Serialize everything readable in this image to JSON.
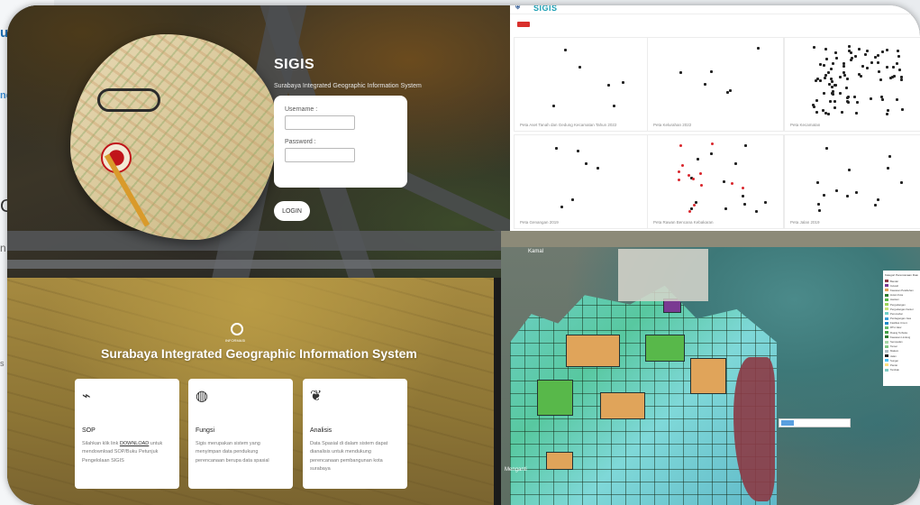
{
  "background_fragment": {
    "t1": "uk",
    "t2": "nd",
    "t3": "C",
    "t4": "n",
    "t5": "s"
  },
  "login": {
    "title": "SIGIS",
    "subtitle": "Surabaya Integrated Geographic Information System",
    "username_label": "Username :",
    "password_label": "Password :",
    "login_button": "LOGIN"
  },
  "gallery": {
    "logo_text": "SIGIS",
    "tiles": [
      {
        "caption": "Peta Aset Tanah dan Gedung Kecamatan Tahun 2022"
      },
      {
        "caption": "Peta Kelurahan 2022"
      },
      {
        "caption": "Peta Kecamatan"
      },
      {
        "caption": "Peta Genangan 2019"
      },
      {
        "caption": "Peta Rawan Bencana Kebakaran"
      },
      {
        "caption": "Peta Jalan 2019"
      }
    ]
  },
  "info": {
    "emblem_label": "INFORMASI",
    "headline": "Surabaya Integrated Geographic Information System",
    "cards": [
      {
        "icon": "chart-icon",
        "title": "SOP",
        "body_pre": "Silahkan klik link ",
        "body_link": "DOWNLOAD",
        "body_post": " untuk mendownload SOP/Buku Petunjuk Pengelolaan SIGIS"
      },
      {
        "icon": "globe-icon",
        "title": "Fungsi",
        "body_pre": "Sigis merupakan sistem yang menyimpan data pendukung perencanaan berupa data spasial",
        "body_link": "",
        "body_post": ""
      },
      {
        "icon": "feather-icon",
        "title": "Analisis",
        "body_pre": "Data Spasial di dalam sistem dapat dianalisis untuk mendukung perencanaan pembangunan kota surabaya",
        "body_link": "",
        "body_post": ""
      }
    ]
  },
  "satellite": {
    "label_top": "Kamal",
    "label_bottom": "Menganti",
    "legend_title": "Kategori Perencanaan Ruang Kota",
    "legend": [
      {
        "name": "Bandar",
        "color": "#8c3a45"
      },
      {
        "name": "Industri",
        "color": "#7a3a92"
      },
      {
        "name": "Kawasan Pelabuhan",
        "color": "#e0a45a"
      },
      {
        "name": "Hutan Kota",
        "color": "#2e7d32"
      },
      {
        "name": "Hankam",
        "color": "#58b84a"
      },
      {
        "name": "Pergudangan",
        "color": "#9bd25a"
      },
      {
        "name": "Pergudangan Kantor",
        "color": "#c7e47a"
      },
      {
        "name": "Perumahan",
        "color": "#6fd0c8"
      },
      {
        "name": "Perdagangan Jasa",
        "color": "#3aa0d8"
      },
      {
        "name": "Fasilitas Umum",
        "color": "#1e88c8"
      },
      {
        "name": "RTH Jalur",
        "color": "#66bb6a"
      },
      {
        "name": "Ruang Terbuka",
        "color": "#43a047"
      },
      {
        "name": "Kawasan Lindung",
        "color": "#2e7d32"
      },
      {
        "name": "Sempadan",
        "color": "#a5d6a7"
      },
      {
        "name": "Taman",
        "color": "#81c784"
      },
      {
        "name": "Makam",
        "color": "#b0bec5"
      },
      {
        "name": "Jalan",
        "color": "#212121"
      },
      {
        "name": "Sungai",
        "color": "#4fc3f7"
      },
      {
        "name": "Pantai",
        "color": "#ffe082"
      },
      {
        "name": "Tambak",
        "color": "#80cbc4"
      }
    ]
  }
}
